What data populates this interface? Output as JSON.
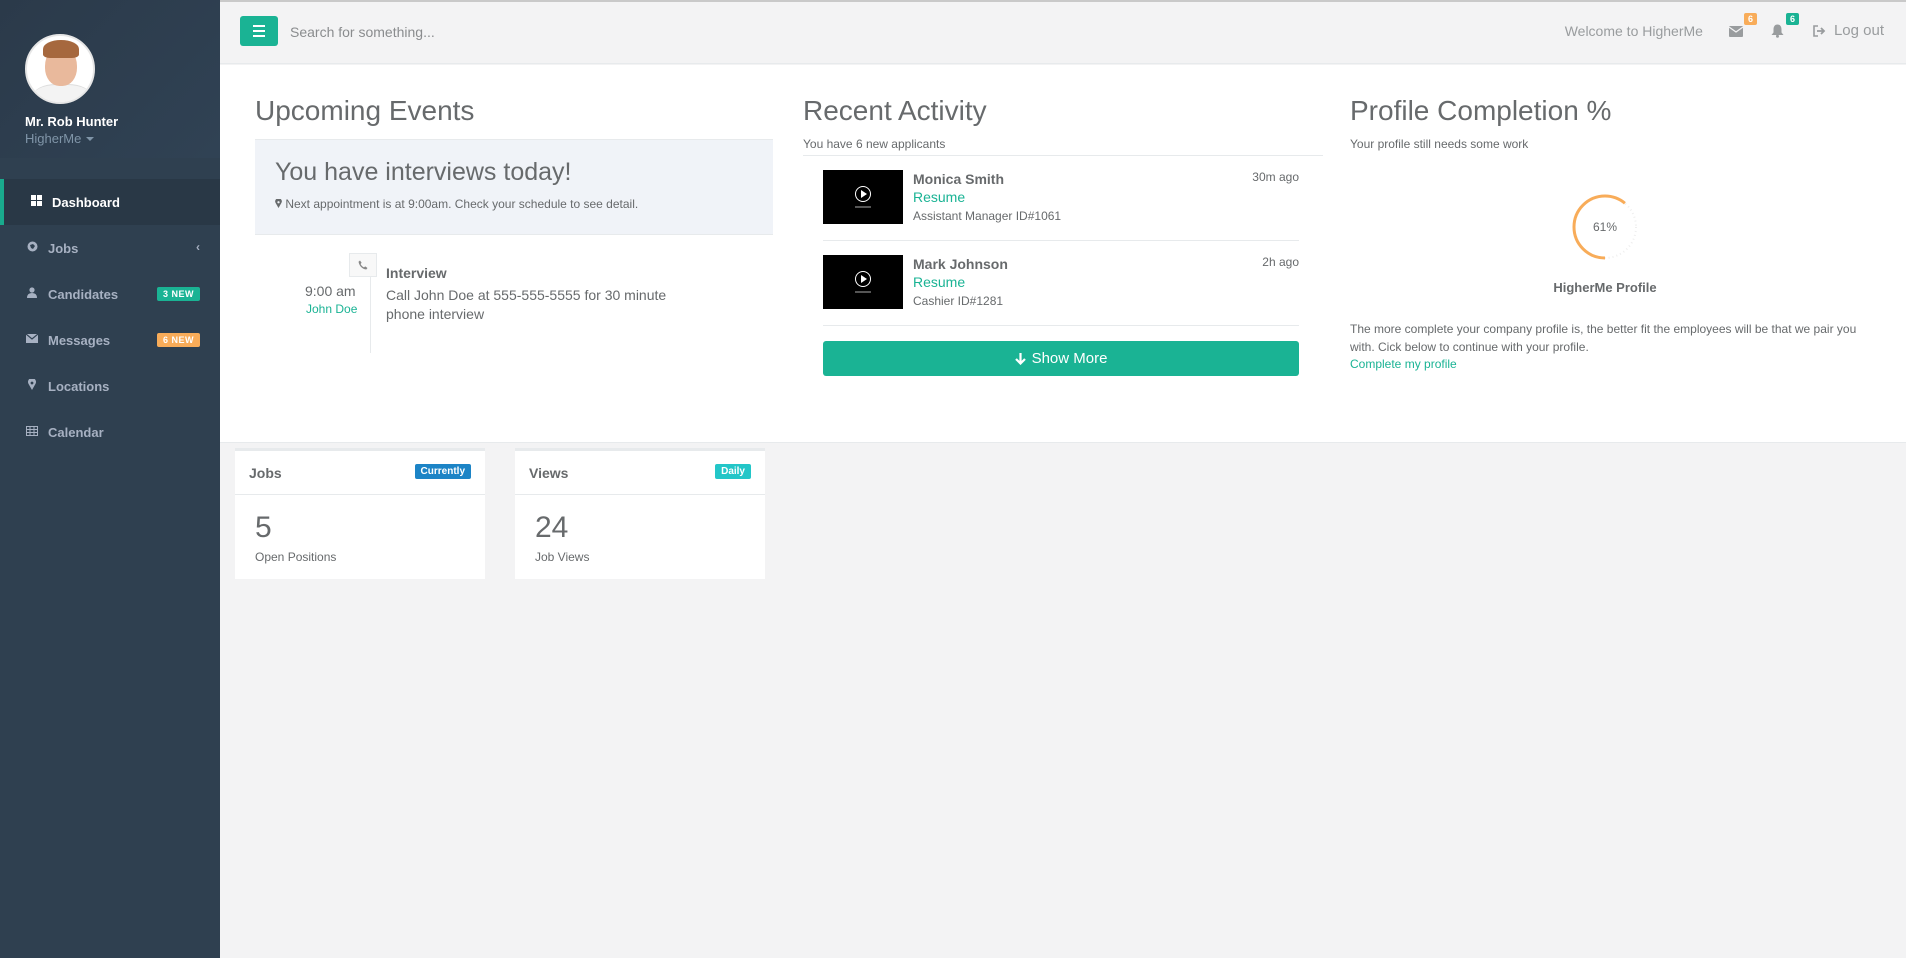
{
  "sidebar": {
    "user_name": "Mr. Rob Hunter",
    "company": "HigherMe",
    "items": [
      {
        "label": "Dashboard",
        "icon": "dashboard-icon",
        "badge": ""
      },
      {
        "label": "Jobs",
        "icon": "globe-icon",
        "badge": ""
      },
      {
        "label": "Candidates",
        "icon": "user-icon",
        "badge": "3 NEW"
      },
      {
        "label": "Messages",
        "icon": "envelope-icon",
        "badge": "6 NEW"
      },
      {
        "label": "Locations",
        "icon": "map-marker-icon",
        "badge": ""
      },
      {
        "label": "Calendar",
        "icon": "table-icon",
        "badge": ""
      }
    ]
  },
  "topbar": {
    "search_placeholder": "Search for something...",
    "welcome": "Welcome to HigherMe",
    "mail_count": "6",
    "notif_count": "6",
    "logout": "Log out"
  },
  "upcoming": {
    "title": "Upcoming Events",
    "banner_title": "You have interviews today!",
    "banner_sub": "Next appointment is at 9:00am. Check your schedule to see detail.",
    "event": {
      "time": "9:00 am",
      "person": "John Doe",
      "title": "Interview",
      "description": "Call John Doe at 555-555-5555 for 30 minute phone interview"
    }
  },
  "recent": {
    "title": "Recent Activity",
    "subtitle": "You have 6 new applicants",
    "applicants": [
      {
        "name": "Monica Smith",
        "link": "Resume",
        "role": "Assistant Manager ID#1061",
        "time": "30m ago"
      },
      {
        "name": "Mark Johnson",
        "link": "Resume",
        "role": "Cashier ID#1281",
        "time": "2h ago"
      }
    ],
    "show_more": "Show More"
  },
  "completion": {
    "title": "Profile Completion %",
    "subtitle": "Your profile still needs some work",
    "percent": 61,
    "percent_label": "61%",
    "gauge_title": "HigherMe Profile",
    "description": "The more complete your company profile is, the better fit the employees will be that we pair you with. Cick below to continue with your profile.",
    "link": "Complete my profile"
  },
  "stats": [
    {
      "title": "Jobs",
      "badge": "Currently",
      "value": "5",
      "label": "Open Positions"
    },
    {
      "title": "Views",
      "badge": "Daily",
      "value": "24",
      "label": "Job Views"
    }
  ],
  "colors": {
    "accent": "#1ab394",
    "sidebar": "#2f4050",
    "orange": "#f8ac59",
    "blue": "#1c84c6",
    "cyan": "#23c6c8"
  }
}
